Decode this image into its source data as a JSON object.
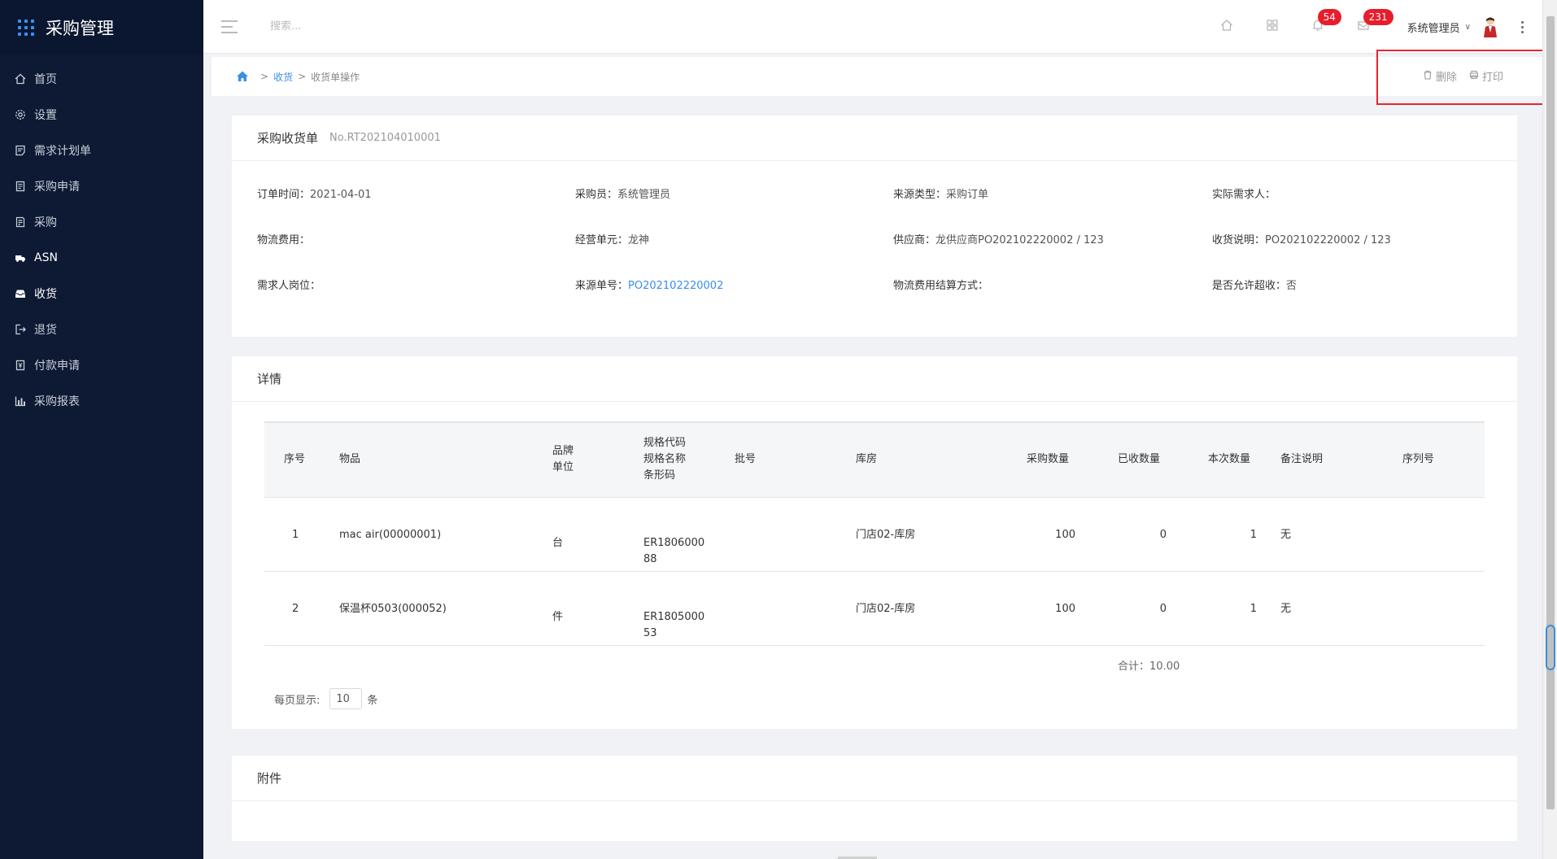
{
  "app": {
    "title": "采购管理"
  },
  "sidebar": {
    "items": [
      {
        "label": "首页",
        "icon": "home-icon"
      },
      {
        "label": "设置",
        "icon": "gear-icon"
      },
      {
        "label": "需求计划单",
        "icon": "plan-icon"
      },
      {
        "label": "采购申请",
        "icon": "request-icon"
      },
      {
        "label": "采购",
        "icon": "purchase-icon"
      },
      {
        "label": "ASN",
        "icon": "truck-icon"
      },
      {
        "label": "收货",
        "icon": "receive-icon"
      },
      {
        "label": "退货",
        "icon": "return-icon"
      },
      {
        "label": "付款申请",
        "icon": "payment-icon"
      },
      {
        "label": "采购报表",
        "icon": "report-icon"
      }
    ],
    "active_index": 6
  },
  "topbar": {
    "search_placeholder": "搜索...",
    "notifications_count": "54",
    "messages_count": "231",
    "username": "系统管理员"
  },
  "breadcrumb": {
    "level1": "收货",
    "level2": "收货单操作"
  },
  "actions": {
    "delete_label": "删除",
    "print_label": "打印"
  },
  "order": {
    "title": "采购收货单",
    "number": "No.RT202104010001",
    "fields": {
      "order_time_label": "订单时间：",
      "order_time": "2021-04-01",
      "buyer_label": "采购员：",
      "buyer": "系统管理员",
      "source_type_label": "来源类型：",
      "source_type": "采购订单",
      "actual_requester_label": "实际需求人：",
      "logistics_fee_label": "物流费用：",
      "business_unit_label": "经营单元：",
      "business_unit": "龙神",
      "supplier_label": "供应商：",
      "supplier": "龙供应商PO202102220002 / 123",
      "receive_note_label": "收货说明：",
      "receive_note": "PO202102220002 / 123",
      "requester_post_label": "需求人岗位：",
      "source_no_label": "来源单号：",
      "source_no": "PO202102220002",
      "logistics_settle_label": "物流费用结算方式：",
      "allow_over_label": "是否允许超收：",
      "allow_over": "否"
    }
  },
  "details": {
    "title": "详情",
    "headers": {
      "seq": "序号",
      "item": "物品",
      "brand": "品牌",
      "unit": "单位",
      "spec_code": "规格代码",
      "spec_name": "规格名称",
      "barcode": "条形码",
      "batch": "批号",
      "warehouse": "库房",
      "purchase_qty": "采购数量",
      "received_qty": "已收数量",
      "current_qty": "本次数量",
      "remark": "备注说明",
      "serial": "序列号"
    },
    "rows": [
      {
        "seq": "1",
        "item": "mac air(00000001)",
        "unit": "台",
        "barcode_l1": "ER1806000",
        "barcode_l2": "88",
        "warehouse": "门店02-库房",
        "purchase_qty": "100",
        "received_qty": "0",
        "current_qty": "1",
        "remark": "无"
      },
      {
        "seq": "2",
        "item": "保温杯0503(000052)",
        "unit": "件",
        "barcode_l1": "ER1805000",
        "barcode_l2": "53",
        "warehouse": "门店02-库房",
        "purchase_qty": "100",
        "received_qty": "0",
        "current_qty": "1",
        "remark": "无"
      }
    ],
    "total_label": "合计：",
    "total_value": "10.00",
    "page_size_label": "每页显示:",
    "page_size": "10",
    "page_size_unit": "条"
  },
  "attachments": {
    "title": "附件"
  },
  "colors": {
    "sidebar_bg": "#0e1a33",
    "link": "#3a8ee6",
    "badge": "#e81d2c",
    "highlight_box": "#e7262f"
  }
}
